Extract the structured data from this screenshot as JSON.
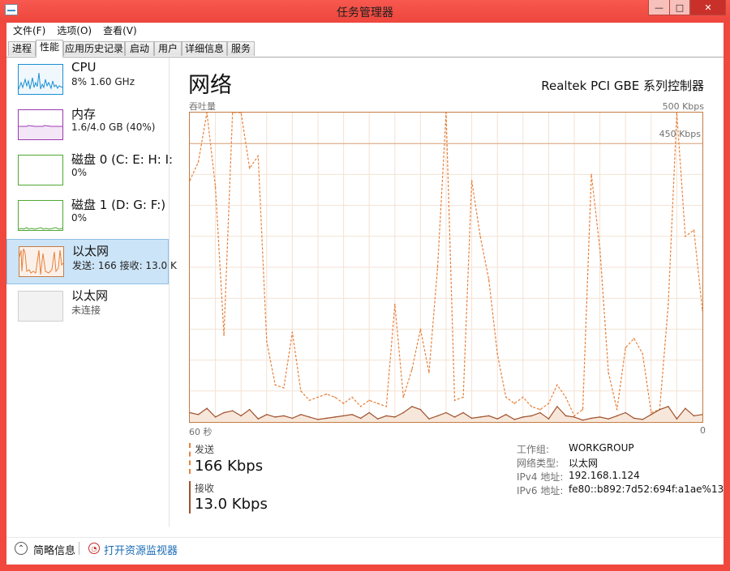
{
  "window": {
    "title": "任务管理器",
    "min_label": "—",
    "max_label": "□",
    "close_label": "✕"
  },
  "menu": [
    "文件(F)",
    "选项(O)",
    "查看(V)"
  ],
  "tabs": [
    "进程",
    "性能",
    "应用历史记录",
    "启动",
    "用户",
    "详细信息",
    "服务"
  ],
  "active_tab": "性能",
  "sidebar": {
    "items": [
      {
        "name": "CPU",
        "value": "8% 1.60 GHz",
        "color": "#1a8fd3"
      },
      {
        "name": "内存",
        "value": "1.6/4.0 GB (40%)",
        "color": "#9b3ab0"
      },
      {
        "name": "磁盘 0 (C: E: H: I:",
        "value": "0%",
        "color": "#4fa832"
      },
      {
        "name": "磁盘 1 (D: G: F:)",
        "value": "0%",
        "color": "#4fa832"
      },
      {
        "name": "以太网",
        "value": "发送: 166 接收: 13.0 K",
        "color": "#c57b44"
      },
      {
        "name": "以太网",
        "value": "未连接",
        "color": "#bcbcbc"
      }
    ],
    "selected_index": 4
  },
  "main": {
    "title": "网络",
    "adapter": "Realtek PCI GBE 系列控制器",
    "throughput_label": "吞吐量",
    "scale_max": "500 Kbps",
    "scale_line": "450 Kbps",
    "time_left": "60 秒",
    "time_right": "0",
    "send_label": "发送",
    "send_value": "166 Kbps",
    "recv_label": "接收",
    "recv_value": "13.0 Kbps",
    "info": [
      {
        "key": "工作组:",
        "value": "WORKGROUP"
      },
      {
        "key": "网络类型:",
        "value": "以太网"
      },
      {
        "key": "IPv4 地址:",
        "value": "192.168.1.124"
      },
      {
        "key": "IPv6 地址:",
        "value": "fe80::b892:7d52:694f:a1ae%13"
      }
    ]
  },
  "footer": {
    "fewer_details": "简略信息",
    "resource_monitor": "打开资源监视器"
  },
  "chart_data": {
    "type": "line",
    "x_unit": "秒",
    "x": [
      60,
      59,
      58,
      57,
      56,
      55,
      54,
      53,
      52,
      51,
      50,
      49,
      48,
      47,
      46,
      45,
      44,
      43,
      42,
      41,
      40,
      39,
      38,
      37,
      36,
      35,
      34,
      33,
      32,
      31,
      30,
      29,
      28,
      27,
      26,
      25,
      24,
      23,
      22,
      21,
      20,
      19,
      18,
      17,
      16,
      15,
      14,
      13,
      12,
      11,
      10,
      9,
      8,
      7,
      6,
      5,
      4,
      3,
      2,
      1,
      0
    ],
    "ylim": [
      0,
      500
    ],
    "series": [
      {
        "name": "发送",
        "color": "#e8803a",
        "dashed": true,
        "values": [
          390,
          420,
          560,
          380,
          140,
          560,
          500,
          410,
          430,
          130,
          60,
          55,
          145,
          50,
          35,
          40,
          45,
          40,
          30,
          40,
          25,
          35,
          30,
          25,
          190,
          40,
          85,
          150,
          80,
          250,
          540,
          35,
          40,
          390,
          300,
          230,
          110,
          40,
          30,
          40,
          25,
          20,
          30,
          60,
          40,
          10,
          20,
          400,
          280,
          80,
          20,
          120,
          135,
          110,
          15,
          20,
          190,
          560,
          300,
          310,
          180
        ]
      },
      {
        "name": "接收",
        "color": "#a0522d",
        "dashed": false,
        "values": [
          15,
          12,
          22,
          8,
          15,
          18,
          10,
          20,
          5,
          12,
          8,
          10,
          6,
          12,
          8,
          4,
          6,
          8,
          10,
          12,
          6,
          15,
          5,
          10,
          8,
          15,
          25,
          20,
          5,
          10,
          15,
          8,
          15,
          6,
          8,
          10,
          5,
          12,
          4,
          8,
          10,
          15,
          5,
          25,
          10,
          8,
          3,
          6,
          8,
          5,
          10,
          15,
          6,
          4,
          12,
          20,
          25,
          5,
          22,
          10,
          12
        ]
      }
    ]
  }
}
